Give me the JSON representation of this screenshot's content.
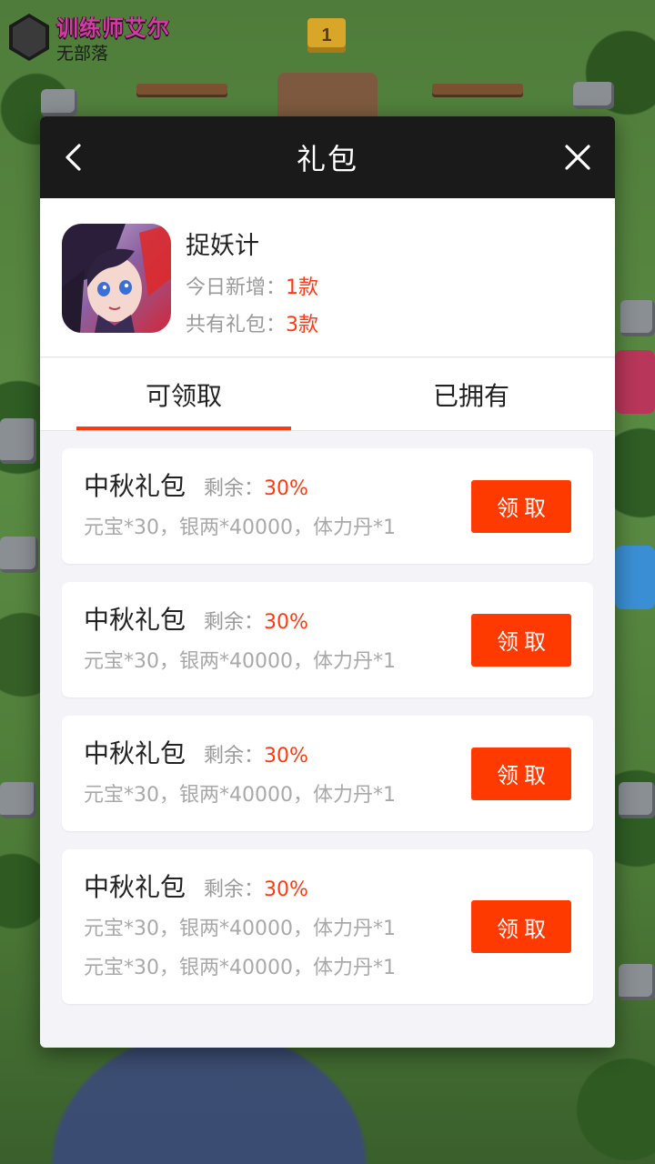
{
  "player": {
    "name": "训练师艾尔",
    "clan": "无部落"
  },
  "background": {
    "crown_level": "1"
  },
  "dialog": {
    "title": "礼包",
    "back_icon": "chevron-left-icon",
    "close_icon": "close-icon"
  },
  "game": {
    "name": "捉妖计",
    "today_label": "今日新增：",
    "today_value": "1款",
    "total_label": "共有礼包：",
    "total_value": "3款"
  },
  "tabs": [
    {
      "label": "可领取",
      "active": true
    },
    {
      "label": "已拥有",
      "active": false
    }
  ],
  "packs": [
    {
      "title": "中秋礼包",
      "remain_label": "剩余：",
      "remain_value": "30%",
      "desc": [
        "元宝*30，银两*40000，体力丹*1"
      ],
      "button": "领取"
    },
    {
      "title": "中秋礼包",
      "remain_label": "剩余：",
      "remain_value": "30%",
      "desc": [
        "元宝*30，银两*40000，体力丹*1"
      ],
      "button": "领取"
    },
    {
      "title": "中秋礼包",
      "remain_label": "剩余：",
      "remain_value": "30%",
      "desc": [
        "元宝*30，银两*40000，体力丹*1"
      ],
      "button": "领取"
    },
    {
      "title": "中秋礼包",
      "remain_label": "剩余：",
      "remain_value": "30%",
      "desc": [
        "元宝*30，银两*40000，体力丹*1",
        "元宝*30，银两*40000，体力丹*1"
      ],
      "button": "领取"
    }
  ],
  "colors": {
    "accent": "#ff3a10",
    "header": "#1a1a1a",
    "button": "#ff3a00"
  }
}
